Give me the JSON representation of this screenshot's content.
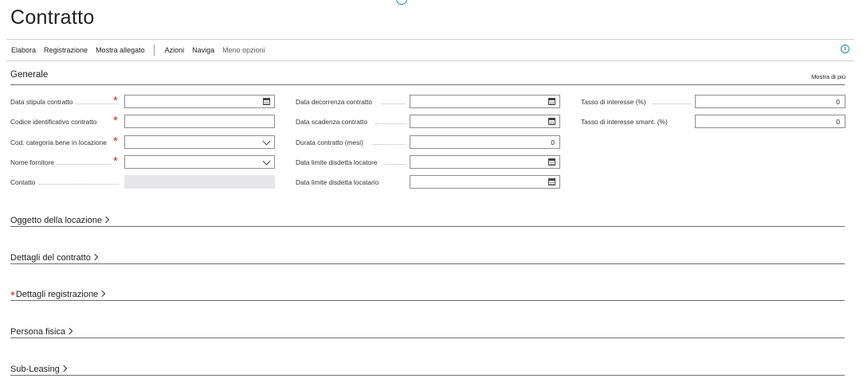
{
  "page": {
    "title": "Contratto"
  },
  "actionbar": {
    "items": [
      "Elabora",
      "Registrazione",
      "Mostra allegato",
      "Azioni",
      "Naviga",
      "Meno opzioni"
    ],
    "info_icon": "i"
  },
  "general": {
    "title": "Generale",
    "show_more": "Mostra di più",
    "col1": [
      {
        "label": "Data stipula contratto",
        "required": true,
        "type": "date",
        "value": ""
      },
      {
        "label": "Codice identificativo contratto",
        "required": true,
        "type": "text",
        "value": ""
      },
      {
        "label": "Cod. categoria bene in locazione",
        "required": true,
        "type": "select",
        "value": ""
      },
      {
        "label": "Nome fornitore",
        "required": true,
        "type": "select",
        "value": ""
      },
      {
        "label": "Contatto",
        "required": false,
        "type": "readonly",
        "value": ""
      }
    ],
    "col2": [
      {
        "label": "Data decorrenza contratto",
        "type": "date",
        "value": ""
      },
      {
        "label": "Data scadenza contratto",
        "type": "date",
        "value": ""
      },
      {
        "label": "Durata contratto (mesi)",
        "type": "number",
        "value": "0"
      },
      {
        "label": "Data limite disdetta locatore",
        "type": "date",
        "value": ""
      },
      {
        "label": "Data limite disdetta locatario",
        "type": "date",
        "value": ""
      }
    ],
    "col3": [
      {
        "label": "Tasso di interesse (%)",
        "type": "number",
        "value": "0"
      },
      {
        "label": "Tasso di interesse smant. (%)",
        "type": "number",
        "value": "0"
      }
    ]
  },
  "sections": [
    {
      "title": "Oggetto della locazione",
      "required": false
    },
    {
      "title": "Dettagli del contratto",
      "required": false
    },
    {
      "title": "Dettagli registrazione",
      "required": true
    },
    {
      "title": "Persona fisica",
      "required": false
    },
    {
      "title": "Sub-Leasing",
      "required": false
    }
  ],
  "colors": {
    "accent": "#1f8fa0",
    "required": "#d22a2a"
  }
}
